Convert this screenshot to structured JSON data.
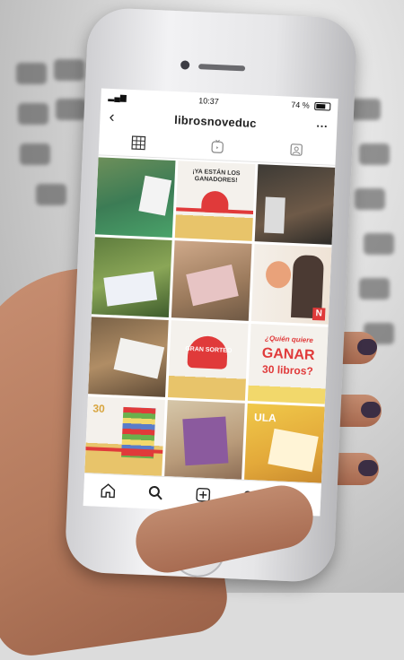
{
  "status_bar": {
    "time": "10:37",
    "battery": "74 %"
  },
  "profile": {
    "username": "librosnoveduc",
    "back_glyph": "‹",
    "more_glyph": "···"
  },
  "tabs": [
    {
      "icon": "grid-icon"
    },
    {
      "icon": "tv-icon"
    },
    {
      "icon": "tagged-icon"
    }
  ],
  "posts": {
    "p2_title": "¡YA ESTÁN LOS GANADORES!",
    "p6_badge": "N",
    "p8_title": "GRAN SORTEO",
    "p9_title_1": "¿Quién quiere",
    "p9_title_2": "GANAR",
    "p9_title_3": "30 libros?",
    "p10_badge": "30",
    "p12_label": "ULA"
  },
  "bottom_nav": [
    {
      "icon": "home-icon"
    },
    {
      "icon": "search-icon"
    },
    {
      "icon": "add-post-icon"
    },
    {
      "icon": "heart-icon"
    },
    {
      "icon": "profile-avatar"
    }
  ],
  "colors": {
    "brand_red": "#e03a3a",
    "gold": "#e8c46a",
    "yellow": "#f2d86b"
  }
}
